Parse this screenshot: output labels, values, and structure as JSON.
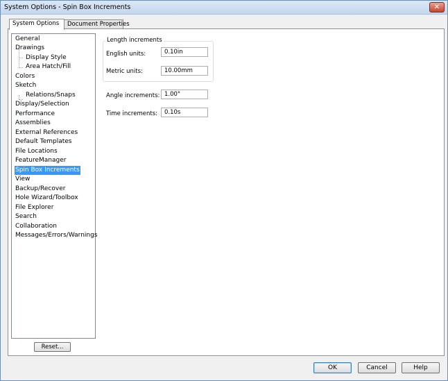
{
  "window": {
    "title": "System Options - Spin Box Increments",
    "close_glyph": "✕"
  },
  "tabs": [
    {
      "label": "System Options",
      "active": true
    },
    {
      "label": "Document Properties",
      "active": false
    }
  ],
  "tree": {
    "items": [
      {
        "label": "General"
      },
      {
        "label": "Drawings"
      },
      {
        "label": "Display Style"
      },
      {
        "label": "Area Hatch/Fill"
      },
      {
        "label": "Colors"
      },
      {
        "label": "Sketch"
      },
      {
        "label": "Relations/Snaps"
      },
      {
        "label": "Display/Selection"
      },
      {
        "label": "Performance"
      },
      {
        "label": "Assemblies"
      },
      {
        "label": "External References"
      },
      {
        "label": "Default Templates"
      },
      {
        "label": "File Locations"
      },
      {
        "label": "FeatureManager"
      },
      {
        "label": "Spin Box Increments"
      },
      {
        "label": "View"
      },
      {
        "label": "Backup/Recover"
      },
      {
        "label": "Hole Wizard/Toolbox"
      },
      {
        "label": "File Explorer"
      },
      {
        "label": "Search"
      },
      {
        "label": "Collaboration"
      },
      {
        "label": "Messages/Errors/Warnings"
      }
    ],
    "selected": "Spin Box Increments"
  },
  "reset_label": "Reset...",
  "length_increments": {
    "group_label": "Length increments",
    "english_label": "English units:",
    "english_value": "0.10in",
    "metric_label": "Metric units:",
    "metric_value": "10.00mm"
  },
  "angle": {
    "label": "Angle increments:",
    "value": "1.00°"
  },
  "time": {
    "label": "Time increments:",
    "value": "0.10s"
  },
  "buttons": {
    "ok": "OK",
    "cancel": "Cancel",
    "help": "Help"
  },
  "colors": {
    "selection": "#3399ff",
    "title_bar": "#c5d7ee",
    "close_button": "#c7452c"
  }
}
